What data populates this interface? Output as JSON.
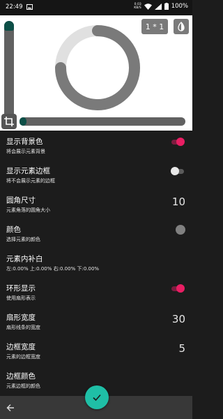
{
  "status_bar": {
    "time": "22:49",
    "net_speed": "0.03",
    "net_unit": "KB/S",
    "battery": "100%"
  },
  "preview": {
    "ratio_label": "1 * 1",
    "ring_track_color": "#e0e0e0",
    "ring_fill_color": "#7a7a7a",
    "ring_progress": 0.75,
    "vertical_slider_value": 0.0,
    "horizontal_slider_value": 0.0,
    "accent": "#0d4f47",
    "icons": [
      "crop-icon",
      "contrast-icon"
    ]
  },
  "settings": [
    {
      "title": "显示背景色",
      "desc": "将会展示元素背景",
      "control": "switch",
      "checked": true
    },
    {
      "title": "显示元素边框",
      "desc": "将不会展示元素的边框",
      "control": "switch",
      "checked": false
    },
    {
      "title": "圆角尺寸",
      "desc": "元素角落的圆角大小",
      "control": "value",
      "value": "10"
    },
    {
      "title": "颜色",
      "desc": "选择元素的颜色",
      "control": "color",
      "color": "#808080"
    },
    {
      "title": "元素内补白",
      "desc": "左:0.00% 上:0.00% 右:0.00% 下:0.00%",
      "control": "none"
    },
    {
      "title": "环形显示",
      "desc": "使用扇形表示",
      "control": "switch",
      "checked": true
    },
    {
      "title": "扇形宽度",
      "desc": "扇形线条的宽度",
      "control": "value",
      "value": "30"
    },
    {
      "title": "边框宽度",
      "desc": "元素的边框宽度",
      "control": "value",
      "value": "5"
    },
    {
      "title": "边框颜色",
      "desc": "元素边框的颜色",
      "control": "none"
    }
  ],
  "bottom_bar": {
    "icons": [
      "back-arrow-icon",
      "check-icon"
    ],
    "fab_color": "#1fbfa6",
    "switch_on_color": "#e91e63"
  }
}
